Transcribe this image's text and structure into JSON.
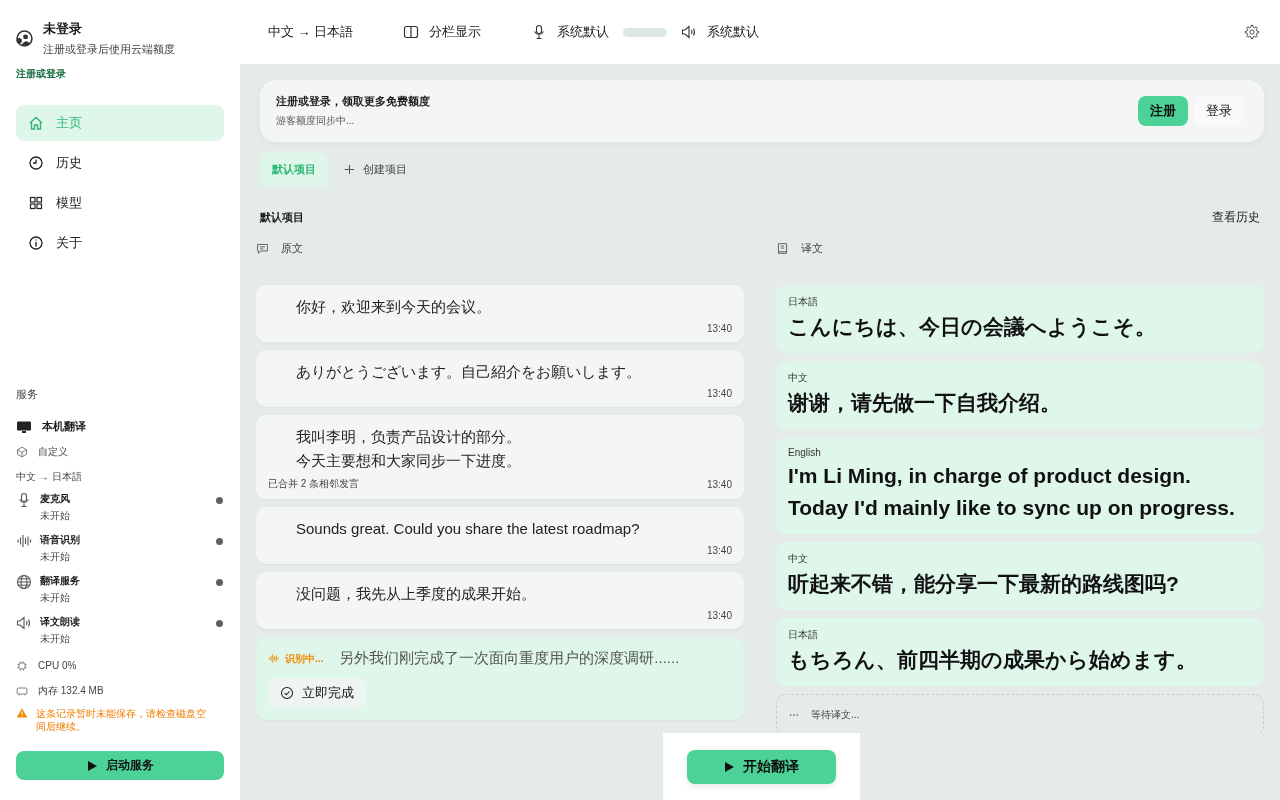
{
  "account": {
    "title": "未登录",
    "subtitle": "注册或登录后使用云端额度",
    "link": "注册或登录"
  },
  "nav": [
    {
      "label": "主页",
      "kind": "home",
      "selected": true
    },
    {
      "label": "历史",
      "kind": "clock",
      "selected": false
    },
    {
      "label": "模型",
      "kind": "grid",
      "selected": false
    },
    {
      "label": "关于",
      "kind": "info",
      "selected": false
    }
  ],
  "services": {
    "heading": "服务",
    "engine": "本机翻译",
    "preset": "自定义",
    "pair": "中文 → 日本語",
    "items": [
      {
        "name": "麦克风",
        "status": "未开始",
        "running": false,
        "kind": "mic"
      },
      {
        "name": "语音识别",
        "status": "未开始",
        "running": false,
        "kind": "wave"
      },
      {
        "name": "翻译服务",
        "status": "未开始",
        "running": false,
        "kind": "globe"
      },
      {
        "name": "译文朗读",
        "status": "未开始",
        "running": false,
        "kind": "speaker"
      }
    ],
    "cpu": "CPU 0%",
    "memory": "内存 132.4 MB",
    "warning": "这条记录暂时未能保存，请检查磁盘空间后继续。",
    "start_button": "启动服务"
  },
  "toolbar": {
    "language_pair": "中文 → 日本語",
    "layout": "分栏显示",
    "input_device": "系统默认",
    "input_meter": {
      "level": 0
    },
    "output_device": "系统默认"
  },
  "banner": {
    "title": "注册或登录，领取更多免费额度",
    "subtitle": "游客额度同步中...",
    "buttons": [
      {
        "label": "注册",
        "primary": true
      },
      {
        "label": "登录",
        "primary": false
      }
    ]
  },
  "project_tabs": [
    {
      "label": "默认项目",
      "selected": true
    }
  ],
  "create_project": "创建项目",
  "project_title": "默认项目",
  "history_link": "查看历史",
  "source": {
    "heading": "原文",
    "items": [
      {
        "kind": "final",
        "lines": [
          "你好，欢迎来到今天的会议。"
        ],
        "time": "13:40"
      },
      {
        "kind": "final",
        "lines": [
          "ありがとうございます。自己紹介をお願いします。"
        ],
        "time": "13:40"
      },
      {
        "kind": "final",
        "lines": [
          "我叫李明，负责产品设计的部分。",
          "今天主要想和大家同步一下进度。"
        ],
        "note": "已合并 2 条相邻发言",
        "time": "13:40"
      },
      {
        "kind": "final",
        "lines": [
          "Sounds great. Could you share the latest roadmap?"
        ],
        "time": "13:40"
      },
      {
        "kind": "final",
        "lines": [
          "没问题，我先从上季度的成果开始。"
        ],
        "time": "13:40"
      },
      {
        "kind": "recognizing",
        "status": "识别中...",
        "lines": [
          "另外我们刚完成了一次面向重度用户的深度调研......"
        ],
        "action": "立即完成"
      }
    ]
  },
  "translation": {
    "heading": "译文",
    "items": [
      {
        "language": "日本語",
        "lines": [
          "こんにちは、今日の会議へようこそ。"
        ]
      },
      {
        "language": "中文",
        "lines": [
          "谢谢，请先做一下自我介绍。"
        ]
      },
      {
        "language": "English",
        "lines": [
          "I'm Li Ming, in charge of product design.",
          "Today I'd mainly like to sync up on progress."
        ]
      },
      {
        "language": "中文",
        "lines": [
          "听起来不错，能分享一下最新的路线图吗?"
        ]
      },
      {
        "language": "日本語",
        "lines": [
          "もちろん、前四半期の成果から始めます。"
        ]
      }
    ],
    "pending": "等待译文..."
  },
  "start_translate": "开始翻译"
}
